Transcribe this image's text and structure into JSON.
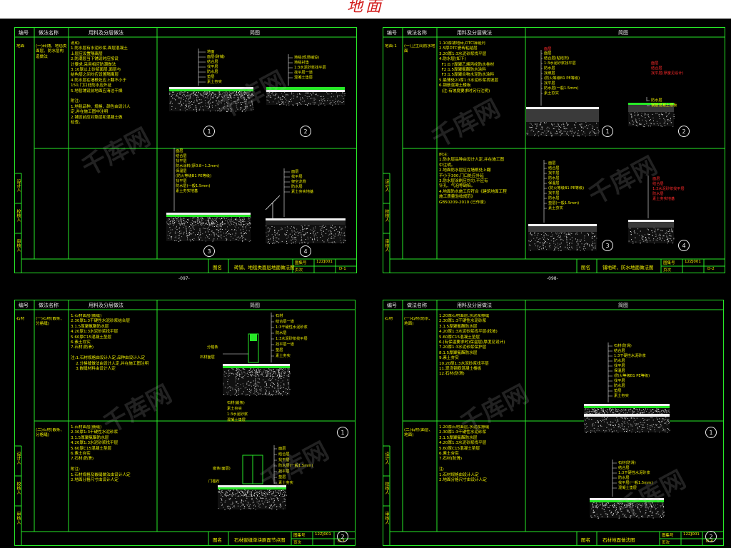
{
  "page_title": "地面",
  "colors": {
    "frame": "#27e827",
    "text": "#f2f200",
    "red": "#ff2a2a",
    "white": "#f0f0f0",
    "title": "#d21c1c"
  },
  "sheets": [
    {
      "id": "s1",
      "header": [
        "编号",
        "做法名称",
        "用料及分层做法",
        "简图"
      ],
      "side_labels": [
        "设计人",
        "校核人",
        "审核人"
      ],
      "page_no": "-097-",
      "title_block": {
        "label": "图名",
        "name": "砖铺、地毯类面层地面做法图",
        "code_label": "图集号",
        "code": "12ZJ001",
        "page_label": "页次",
        "page": "D-1"
      },
      "rows": [
        {
          "code": "地面",
          "name": "(一)砖铺、地毯类面层、防水层构造做法",
          "method": "说明:\n1.防水层有水泥砂浆,面层混凝土\n上层应设置隔离层\n2.防潮层当下铺设时应按设\n计要求,采用相应防潮做法\n3.10厚以上砂浆面层,面层与\n结构层之间均应设置隔离层\n4.防水层在墙根处应上翻不小于\n150,门口处防水应外延\n5.地毯铺设前地面应清洁干燥\n\n附注:\n1.地毯品种、规格、颜色由设计人\n定,并在施工图中注明\n2.铺设前应对垫层和混凝土做\n检查。",
          "callouts": [
            "1",
            "2"
          ]
        },
        {
          "code": "",
          "name": "",
          "method": "",
          "callouts": [
            "3",
            "4"
          ]
        }
      ],
      "labels": {
        "d1": [
          "地面",
          "面层(砖铺)",
          "结合层",
          "找平层",
          "防水层",
          "垫层",
          "素土夯实"
        ],
        "d2": [
          "地毯(现场铺设)",
          "地毯衬垫",
          "1:3水泥砂浆找平层",
          "找平层一道",
          "混凝土垫层"
        ],
        "d3": [
          "面层",
          "结合层",
          "找平层",
          "防水涂料(厚0.8~1.2mm)",
          "保温层",
          "(防火等级B1 PE等级)",
          "找平层",
          "防水层(一般1.5mm)",
          "素土夯实地基"
        ],
        "d4": [
          "面层",
          "找平层",
          "架空龙骨",
          "防水层",
          "素土夯实地基"
        ]
      }
    },
    {
      "id": "s2",
      "header": [
        "编号",
        "做法名称",
        "用料及分层做法",
        "简图"
      ],
      "side_labels": [
        "设计人",
        "校核人",
        "审核人"
      ],
      "page_no": "-098-",
      "title_block": {
        "label": "图名",
        "name": "铺地砖、防水地面做法图",
        "code_label": "图集号",
        "code": "12ZJ001",
        "page_label": "页次",
        "page": "D-2"
      },
      "rows": [
        {
          "code": "地面-1",
          "name": "(一)卫生间防水地面",
          "method": "1.10厚铺地砖,DTC填缝剂\n2.5厚DTC瓷砖粘结层\n3.20厚1:3水泥砂浆找平层\n4.防水层(如下)\n  F1:0.7厚聚乙烯丙纶防水卷材\n  F2:1.5厚聚氨酯防水涂料\n  F3:1.5厚聚合物水泥防水涂料\n5.最薄处20厚1:3水泥砂浆找坡层\n6.钢筋混凝土楼板\n  (注:有坡度要求时另行注明)",
          "callouts": [
            "1",
            "2"
          ]
        },
        {
          "code": "",
          "name": "",
          "method": "附注:\n1.防水层品种由设计人定,并在施工图\n中注明。\n2.地面防水层应在墙根处上翻\n不小于300,门口处应外延\n3.防水层涂刷应均匀,不应有\n针孔、气泡等缺陷。\n4.地面防水施工应符合《建筑地面工程\n施工质量验收规范》\nGB50209-2010 (已作废)",
          "callouts": [
            "3",
            "4"
          ]
        }
      ],
      "labels": {
        "d1": [
          "面层",
          "结合层(粘结剂)",
          "1:3水泥砂浆找平层",
          "防水层",
          "找坡层",
          "(防火等级B1 PE等级)",
          "找平层",
          "防水层(一般1.5mm)",
          "素土夯实"
        ],
        "d1_red": [
          "面层"
        ],
        "d2_red": [
          "面层",
          "结合层",
          "找平层(厚度见设计)"
        ],
        "d2": [
          "防水层",
          "钢筋混凝土楼板"
        ],
        "d3": [
          "面层",
          "结合层",
          "找平层",
          "防水层",
          "保温层",
          "(防火等级B1 PE等级)",
          "找平层",
          "防水层",
          "垫层(一般1.5mm)",
          "素土夯实"
        ],
        "d4_red": [
          "面层",
          "结合层",
          "1:3水泥砂浆找平层",
          "防水层",
          "素土夯实地基"
        ]
      }
    },
    {
      "id": "s3",
      "header": [
        "编号",
        "做法名称",
        "用料及分层做法",
        "简图"
      ],
      "side_labels": [
        "设计人",
        "校核人",
        "审核人"
      ],
      "page_no": "",
      "title_block": {
        "label": "图名",
        "name": "石材嵌缝单块刷面节点图",
        "code_label": "图集号",
        "code": "12ZJ001",
        "page_label": "页次",
        "page": "D-3"
      },
      "rows": [
        {
          "code": "石材",
          "name": "(一)石材(嵌条、分格缝)",
          "method": "1.石材面层(嵌缝)\n2.30厚1:3干硬性水泥砂浆结合层\n3.1.5厚聚氨酯防水层\n4.20厚1:3水泥砂浆找平层\n5.60厚C15混凝土垫层\n6.素土夯实\n7.石材(防滑)\n\n注:1.石材规格由设计人定,品种由设计人定\n    2.分格缝做法由设计人定,并在施工图注明\n    3.嵌缝材料由设计人定",
          "callouts": [
            "1"
          ]
        },
        {
          "code": "",
          "name": "(二)石材(嵌条、分格缝)",
          "method": "1.石材面层(嵌缝)\n2.30厚1:3干硬性水泥砂浆\n3.1.5厚聚氨酯防水层\n4.20厚1:3水泥砂浆找平层\n5.60厚C15混凝土垫层\n6.素土夯实\n7.石材(防滑)\n\n附注:\n1.石材规格及嵌缝做法由设计人定\n2.地面分格尺寸由设计人定",
          "callouts": [
            "2"
          ]
        }
      ],
      "labels": {
        "d1": [
          "石材",
          "结合层一道",
          "1:3干硬性水泥砂浆",
          "防水层",
          "1:3水泥砂浆找平层",
          "找平层一道",
          "垫层",
          "素土夯实"
        ],
        "d1_left": [
          "分格条",
          "石材面层"
        ],
        "d1_bottom": [
          "石材(嵌条)",
          "素土夯实",
          "1:3水泥砂浆",
          "混凝土垫层"
        ],
        "d2": [
          "面层",
          "结合层",
          "找平层",
          "防水层(一般1.5mm)",
          "找平层",
          "垫层",
          "素土夯实"
        ],
        "d2_left": [
          "嵌条(面层)",
          "门槛石"
        ]
      }
    },
    {
      "id": "s4",
      "header": [
        "编号",
        "做法名称",
        "用料及分层做法",
        "简图"
      ],
      "side_labels": [
        "设计人",
        "校核人",
        "审核人"
      ],
      "page_no": "",
      "title_block": {
        "label": "图名",
        "name": "石材地面做法图",
        "code_label": "图集号",
        "code": "12ZJ001",
        "page_label": "页次",
        "page": "D-4"
      },
      "rows": [
        {
          "code": "石材",
          "name": "(一)石材(防水、地面)",
          "method": "1.20厚石材面层,水泥浆擦缝\n2.30厚1:3干硬性水泥砂浆\n3.1.5厚聚氨酯防水层\n4.20厚1:3水泥砂浆找平层(找坡)\n5.60厚C15混凝土垫层\n6.(有保温要求时)保温层(厚度见设计)\n7.20厚1:3水泥砂浆保护层\n8.1.5厚聚氨酯防水层\n9.素土夯实\n10.20厚1:3水泥砂浆找平层\n11.现浇钢筋混凝土楼板\n12.石材(防滑)",
          "callouts": [
            "1"
          ]
        },
        {
          "code": "",
          "name": "(二)石材(面层、地面)",
          "method": "1.20厚石材面层,水泥浆擦缝\n2.30厚1:3干硬性水泥砂浆\n3.1.5厚聚氨酯防水层\n4.20厚1:3水泥砂浆找平层\n5.60厚C15混凝土垫层\n6.素土夯实\n7.石材(防滑)\n\n注:\n1.石材规格由设计人定\n2.地面分格尺寸由设计人定",
          "callouts": [
            "2"
          ]
        }
      ],
      "labels": {
        "d1": [
          "石材(防滑)",
          "结合层",
          "1:3干硬性水泥砂浆",
          "防水层",
          "找平层",
          "保温层",
          "(防火等级B1 PE等级)",
          "找平层",
          "防水层",
          "垫层",
          "素土夯实"
        ],
        "d2": [
          "石材(防滑)",
          "结合层",
          "1:3干硬性水泥砂浆",
          "防水层",
          "找平层(一般1.5mm)",
          "混凝土垫层"
        ]
      }
    }
  ],
  "watermarks": [
    "千库网",
    "千库网",
    "千库网",
    "千库网",
    "千库网",
    "千库网",
    "千库网",
    "千库网"
  ]
}
